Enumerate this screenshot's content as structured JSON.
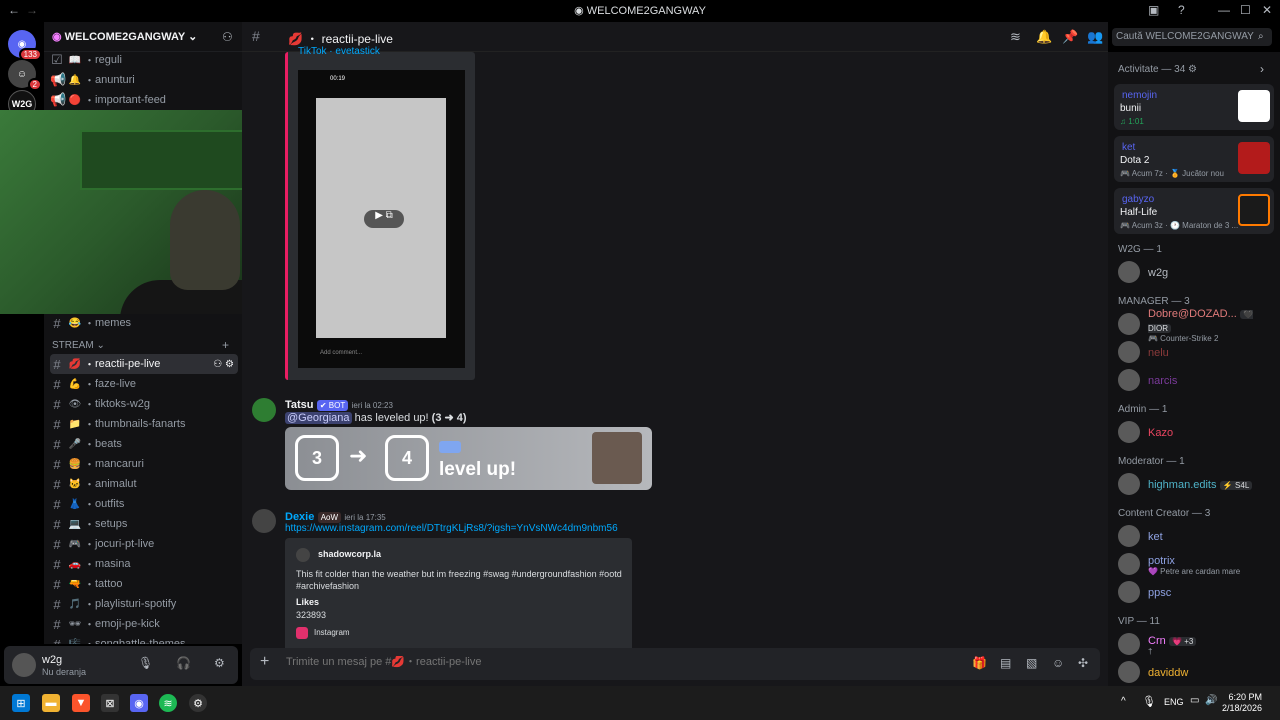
{
  "window": {
    "title": "WELCOME2GANGWAY",
    "back": "←",
    "forward": "→"
  },
  "colors": {
    "accent": "#5865f2",
    "link": "#00a8fc",
    "danger": "#da373c",
    "online": "#23a55a",
    "idle": "#f0b232"
  },
  "servers": [
    {
      "name": "Discord",
      "badge": "133"
    },
    {
      "name": "DM",
      "badge": "2"
    },
    {
      "name": "W2G",
      "badge": ""
    }
  ],
  "server": {
    "name": "WELCOME2GANGWAY"
  },
  "channels_top": [
    {
      "emoji": "📖",
      "name": "reguli"
    },
    {
      "emoji": "🔔",
      "name": "anunturi"
    },
    {
      "emoji": "🔴",
      "name": "important-feed"
    }
  ],
  "channel_memes": {
    "emoji": "😂",
    "name": "memes"
  },
  "category_stream": "STREAM",
  "channels_stream": [
    {
      "emoji": "💋",
      "name": "reactii-pe-live",
      "active": true
    },
    {
      "emoji": "💪",
      "name": "faze-live"
    },
    {
      "emoji": "👁",
      "name": "tiktoks-w2g"
    },
    {
      "emoji": "📁",
      "name": "thumbnails-fanarts"
    },
    {
      "emoji": "🎤",
      "name": "beats"
    },
    {
      "emoji": "🍔",
      "name": "mancaruri"
    },
    {
      "emoji": "🐱",
      "name": "animalut"
    },
    {
      "emoji": "👗",
      "name": "outfits"
    },
    {
      "emoji": "💻",
      "name": "setups"
    },
    {
      "emoji": "🎮",
      "name": "jocuri-pt-live"
    },
    {
      "emoji": "🚗",
      "name": "masina"
    },
    {
      "emoji": "🔫",
      "name": "tattoo"
    },
    {
      "emoji": "🎵",
      "name": "playlisturi-spotify"
    },
    {
      "emoji": "🕶",
      "name": "emoji-pe-kick"
    },
    {
      "emoji": "🎼",
      "name": "songbattle-themes"
    }
  ],
  "user": {
    "name": "w2g",
    "status": "Nu deranja"
  },
  "channel": {
    "name": "reactii-pe-live",
    "emoji": "💋"
  },
  "search": {
    "placeholder": "Caută WELCOME2GANGWAY"
  },
  "embed_video": {
    "title": "TikTok · evetastick",
    "time": "00:19",
    "comment_hint": "Add comment..."
  },
  "messages": [
    {
      "author": "Tatsu",
      "tag": "✔ BOT",
      "time": "ieri la 02:23",
      "mention": "@Georgiana",
      "text": "has leveled up!",
      "levels": "(3 ➜ 4)",
      "from_level": "3",
      "to_level": "4",
      "card_text": "level up!"
    },
    {
      "author": "Dexie",
      "tag": "AoW",
      "time": "ieri la 17:35",
      "link": "https://www.instagram.com/reel/DTtrgKLjRs8/?igsh=YnVsNWc4dm9nbm56",
      "embed_site": "shadowcorp.la",
      "embed_desc": "This fit colder than the weather but im freezing #swag #undergroundfashion #ootd #archivefashion",
      "likes_label": "Likes",
      "likes": "323893",
      "footer": "Instagram"
    }
  ],
  "composer": {
    "placeholder": "Trimite un mesaj pe #💋・reactii-pe-live"
  },
  "activity": {
    "header": "Activitate — 34",
    "items": [
      {
        "user": "nemojin",
        "title": "bunii",
        "sub": "♫ 1:01"
      },
      {
        "user": "ket",
        "title": "Dota 2",
        "sub": "🎮 Acum 7z · 🏅 Jucător nou"
      },
      {
        "user": "gabyzo",
        "title": "Half-Life",
        "sub": "🎮 Acum 3z · 🕐 Maraton de 3 ..."
      }
    ]
  },
  "member_groups": [
    {
      "header": "W2G — 1",
      "members": [
        {
          "name": "w2g",
          "sub": "",
          "color": "#b5bac1"
        }
      ]
    },
    {
      "header": "MANAGER — 3",
      "members": [
        {
          "name": "Dobre@DOZAD...",
          "sub": "🎮 Counter-Strike 2",
          "color": "#e07a7a",
          "badge": "🖤 DIOR"
        },
        {
          "name": "nelu",
          "sub": "",
          "color": "#8a3a3a"
        },
        {
          "name": "narcis",
          "sub": "",
          "color": "#7a3a9a"
        }
      ]
    },
    {
      "header": "Admin — 1",
      "members": [
        {
          "name": "Kazo",
          "sub": "",
          "color": "#e94560"
        }
      ]
    },
    {
      "header": "Moderator — 1",
      "members": [
        {
          "name": "highman.edits",
          "sub": "",
          "color": "#4fb3c8",
          "badge": "⚡ S4L"
        }
      ]
    },
    {
      "header": "Content Creator — 3",
      "members": [
        {
          "name": "ket",
          "sub": "",
          "color": "#8ea1e1"
        },
        {
          "name": "potrix",
          "sub": "💜 Petre are cardan mare",
          "color": "#8ea1e1"
        },
        {
          "name": "ppsc",
          "sub": "",
          "color": "#8ea1e1"
        }
      ]
    },
    {
      "header": "VIP — 11",
      "members": [
        {
          "name": "Crn",
          "sub": "†",
          "color": "#f47fff",
          "badge": "💗 +3"
        },
        {
          "name": "daviddw",
          "sub": "",
          "color": "#f0b232"
        }
      ]
    }
  ],
  "taskbar": {
    "lang": "ENG",
    "time": "6:20 PM",
    "date": "2/18/2026",
    "chevron": "^"
  }
}
